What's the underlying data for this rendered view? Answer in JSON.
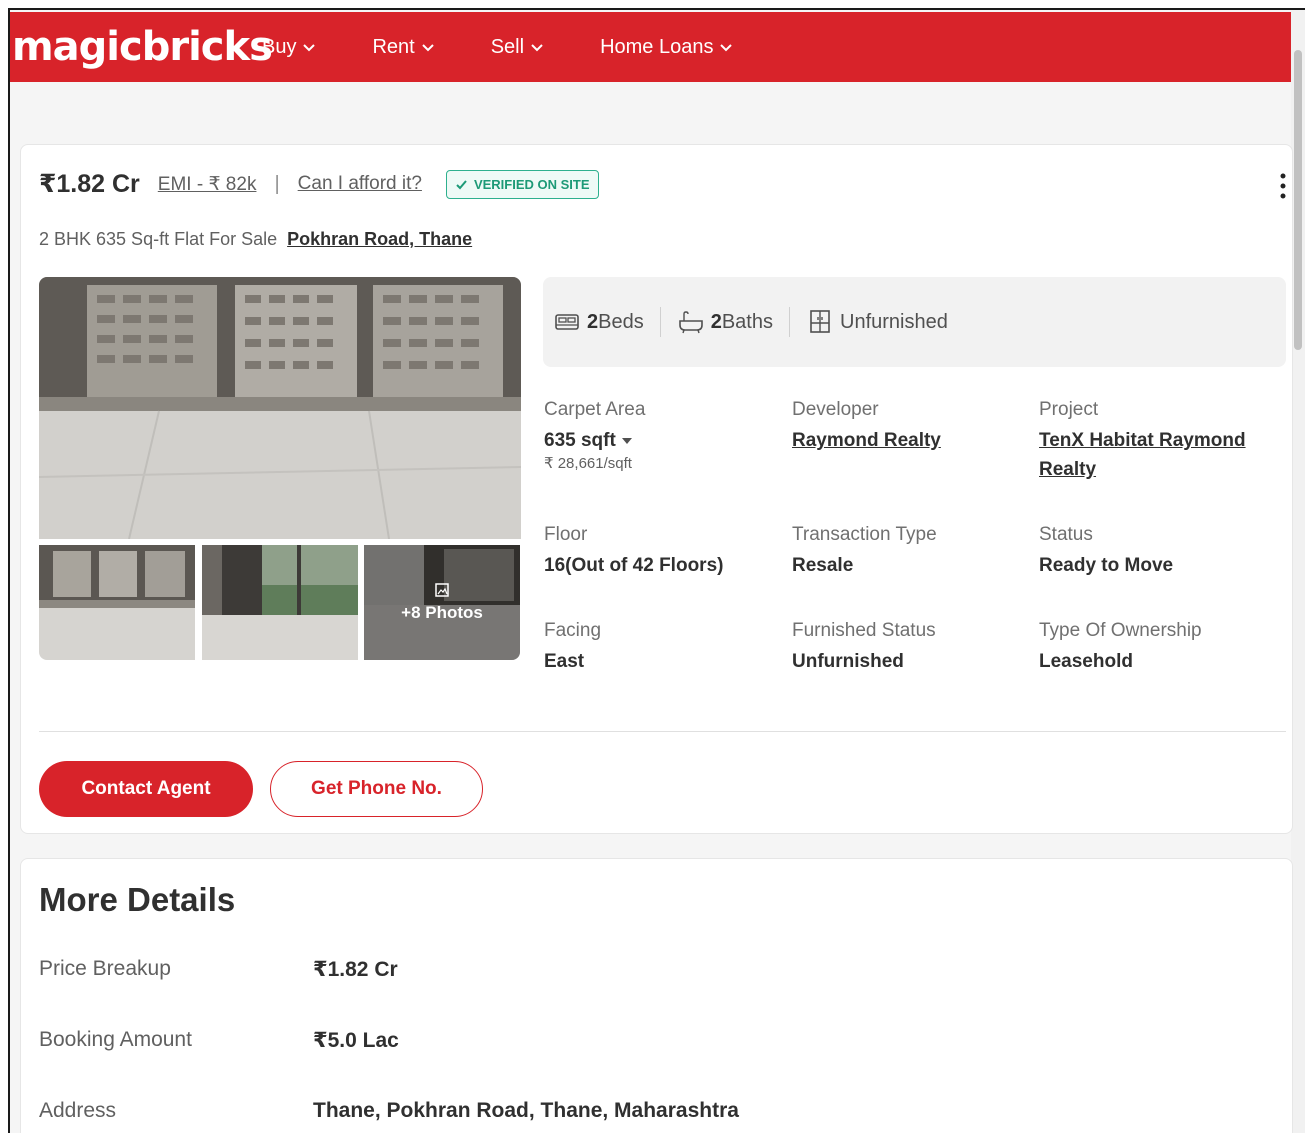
{
  "header": {
    "logo": "magicbricks",
    "nav": [
      "Buy",
      "Rent",
      "Sell",
      "Home Loans"
    ]
  },
  "listing": {
    "price": "₹1.82 Cr",
    "emi": "EMI - ₹ 82k",
    "separator": "|",
    "afford": "Can I afford it?",
    "verified": "VERIFIED ON SITE",
    "title": "2 BHK 635 Sq-ft Flat For Sale",
    "location": "Pokhran Road, Thane",
    "more_photos": "+8 Photos",
    "amenities": {
      "beds_num": "2",
      "beds_label": "Beds",
      "baths_num": "2",
      "baths_label": "Baths",
      "furnishing": "Unfurnished"
    },
    "details": {
      "carpet_area_label": "Carpet Area",
      "carpet_area_value": "635 sqft",
      "carpet_area_rate": "₹ 28,661/sqft",
      "developer_label": "Developer",
      "developer_value": "Raymond Realty",
      "project_label": "Project",
      "project_value": "TenX Habitat Raymond Realty",
      "floor_label": "Floor",
      "floor_value": "16(Out of 42 Floors)",
      "transaction_label": "Transaction Type",
      "transaction_value": "Resale",
      "status_label": "Status",
      "status_value": "Ready to Move",
      "facing_label": "Facing",
      "facing_value": "East",
      "furnished_label": "Furnished Status",
      "furnished_value": "Unfurnished",
      "ownership_label": "Type Of Ownership",
      "ownership_value": "Leasehold"
    },
    "contact_button": "Contact Agent",
    "phone_button": "Get Phone No."
  },
  "more_details": {
    "title": "More Details",
    "rows": [
      {
        "label": "Price Breakup",
        "value": "₹1.82 Cr"
      },
      {
        "label": "Booking Amount",
        "value": "₹5.0 Lac"
      },
      {
        "label": "Address",
        "value": "Thane, Pokhran Road, Thane, Maharashtra"
      }
    ]
  },
  "colors": {
    "brand": "#d8232a",
    "verified": "#1d9a77"
  }
}
